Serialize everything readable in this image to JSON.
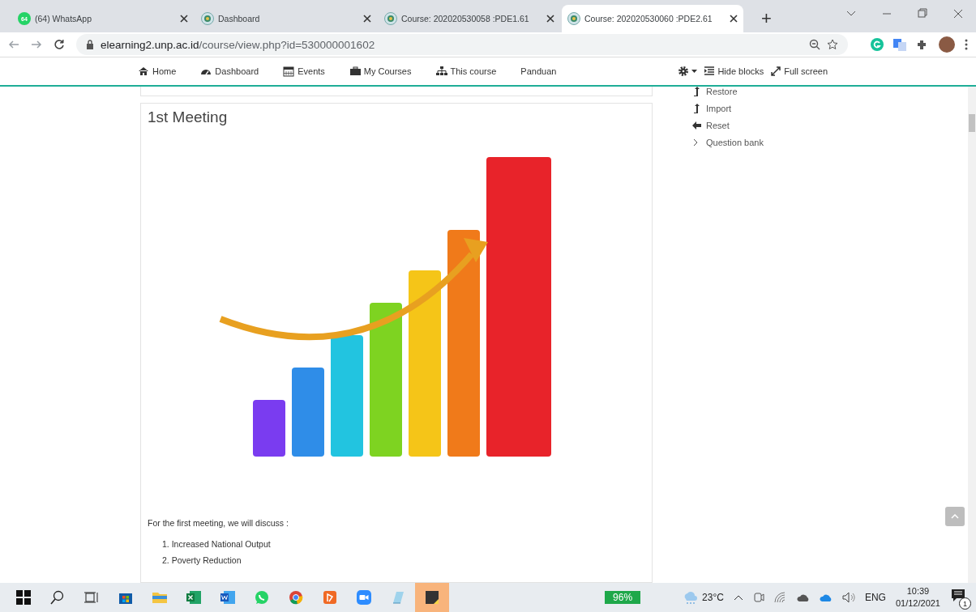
{
  "browser": {
    "tabs": [
      {
        "title": "(64) WhatsApp",
        "kind": "whatsapp",
        "badge": "64",
        "selected": false
      },
      {
        "title": "Dashboard",
        "kind": "site",
        "selected": false
      },
      {
        "title": "Course: 202020530058 :PDE1.61",
        "kind": "site",
        "selected": false
      },
      {
        "title": "Course: 202020530060 :PDE2.61",
        "kind": "site",
        "selected": true
      }
    ],
    "new_tab": "+",
    "url": {
      "host": "elearning2.unp.ac.id",
      "path": "/course/view.php?id=530000001602"
    }
  },
  "navbar": {
    "items": [
      {
        "label": "Home",
        "kind": "home"
      },
      {
        "label": "Dashboard",
        "kind": "gauge"
      },
      {
        "label": "Events",
        "kind": "calendar"
      },
      {
        "label": "My Courses",
        "kind": "briefcase"
      },
      {
        "label": "This course",
        "kind": "sitemap"
      },
      {
        "label": "Panduan",
        "kind": "plain"
      }
    ],
    "tools": [
      {
        "label": "Hide blocks",
        "kind": "indent"
      },
      {
        "label": "Full screen",
        "kind": "expand"
      }
    ]
  },
  "section": {
    "title": "1st Meeting",
    "intro": "For the first meeting, we will discuss :",
    "topics": [
      "1. Increased National Output",
      "2. Poverty Reduction"
    ]
  },
  "admin_block": {
    "items": [
      {
        "label": "Restore",
        "kind": "upload"
      },
      {
        "label": "Import",
        "kind": "upload"
      },
      {
        "label": "Reset",
        "kind": "left"
      },
      {
        "label": "Question bank",
        "kind": "chevron"
      }
    ]
  },
  "taskbar": {
    "apps": [
      {
        "kind": "store",
        "highlighted": false
      },
      {
        "kind": "folder",
        "highlighted": false
      },
      {
        "kind": "excel",
        "highlighted": false
      },
      {
        "kind": "word",
        "highlighted": false
      },
      {
        "kind": "whatsapp",
        "highlighted": false
      },
      {
        "kind": "chrome",
        "highlighted": false
      },
      {
        "kind": "pdf",
        "highlighted": false
      },
      {
        "kind": "zoom",
        "highlighted": false
      },
      {
        "kind": "notepad",
        "highlighted": false
      },
      {
        "kind": "sticky",
        "highlighted": true
      }
    ],
    "battery": "96%",
    "weather": "23°C",
    "language": "ENG",
    "time": "10:39",
    "date": "01/12/2021",
    "notifications": "1"
  }
}
